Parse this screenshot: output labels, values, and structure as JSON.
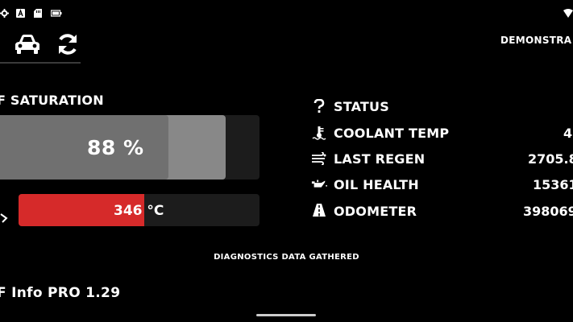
{
  "status_bar": {
    "left_icons": [
      "gear-icon",
      "a-icon",
      "sd-card-icon",
      "battery-icon"
    ],
    "right_icons": [
      "wifi-icon"
    ]
  },
  "toolbar": {
    "buttons": [
      {
        "icon": "car-icon"
      },
      {
        "icon": "refresh-icon"
      }
    ],
    "mode_label": "DEMONSTRA"
  },
  "saturation": {
    "title": "F SATURATION",
    "value": "88 %",
    "fraction": 0.88,
    "secondary_fraction": 0.87
  },
  "temperature": {
    "value": "346 °C",
    "fraction": 0.52
  },
  "status_list": [
    {
      "icon": "question-icon",
      "label": "STATUS",
      "value": ""
    },
    {
      "icon": "thermometer-icon",
      "label": "COOLANT TEMP",
      "value": "4"
    },
    {
      "icon": "regen-icon",
      "label": "LAST REGEN",
      "value": "2705.8"
    },
    {
      "icon": "oil-can-icon",
      "label": "OIL HEALTH",
      "value": "15361"
    },
    {
      "icon": "road-icon",
      "label": "ODOMETER",
      "value": "398069"
    }
  ],
  "message": "DIAGNOSTICS DATA GATHERED",
  "app_version": "F Info PRO 1.29",
  "colors": {
    "background": "#000000",
    "bar_primary": "#707070",
    "bar_secondary": "#888888",
    "track": "#1c1c1c",
    "temperature_fill": "#d62a2a",
    "text": "#ffffff"
  }
}
